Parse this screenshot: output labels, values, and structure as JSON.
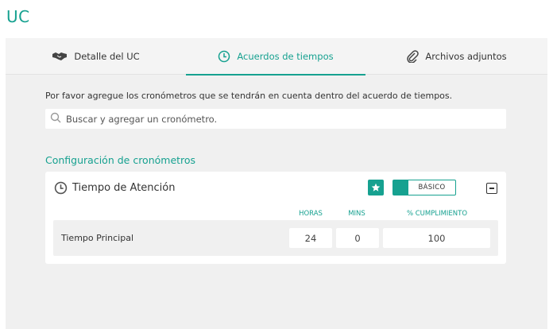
{
  "page": {
    "title": "UC"
  },
  "tabs": [
    {
      "label": "Detalle del UC",
      "icon": "handshake-icon",
      "active": false
    },
    {
      "label": "Acuerdos de tiempos",
      "icon": "clock-icon",
      "active": true
    },
    {
      "label": "Archivos adjuntos",
      "icon": "paperclip-icon",
      "active": false
    }
  ],
  "content": {
    "instructions": "Por favor agregue los cronómetros que se tendrán en cuenta dentro del acuerdo de tiempos.",
    "search": {
      "placeholder": "Buscar y agregar un cronómetro.",
      "value": ""
    },
    "section_title": "Configuración de cronómetros"
  },
  "card": {
    "title": "Tiempo de Atención",
    "icon": "clock-icon",
    "toggle_label": "BÁSICO",
    "columns": {
      "hours": "HORAS",
      "mins": "MINS",
      "compliance": "% CUMPLIMIENTO"
    },
    "rows": [
      {
        "label": "Tiempo Principal",
        "hours": "24",
        "mins": "0",
        "compliance": "100"
      }
    ]
  },
  "colors": {
    "accent": "#16a190",
    "panel_bg": "#f0f0f0",
    "card_bg": "#ffffff"
  }
}
